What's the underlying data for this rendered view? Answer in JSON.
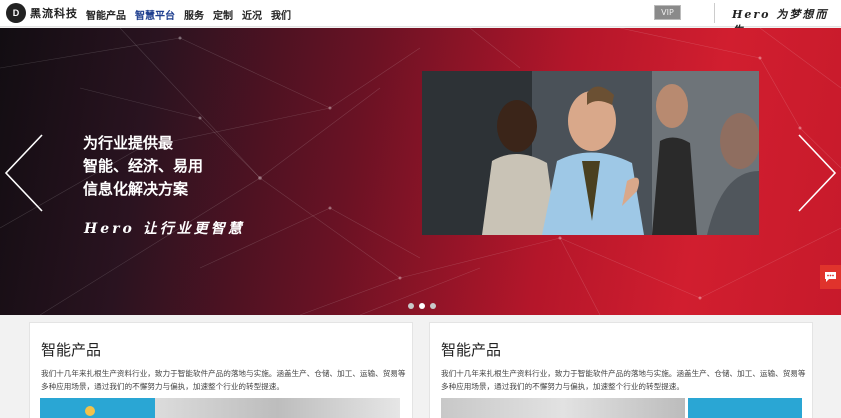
{
  "header": {
    "logo_mark": "D",
    "logo_text": "黑流科技",
    "nav": [
      "智能产品",
      "智慧平台",
      "服务",
      "定制",
      "近况",
      "我们"
    ],
    "active_index": 1,
    "vip_label": "VIP",
    "slogan": "Hero 为梦想而生"
  },
  "banner": {
    "headline": [
      "为行业提供最",
      "智能、经济、易用",
      "信息化解决方案"
    ],
    "slogan": "Hero 让行业更智慧",
    "slides": 3,
    "active_slide": 1
  },
  "cards": [
    {
      "title": "智能产品",
      "desc": "我们十几年来扎根生产资料行业，致力于智能软件产品的落地与实施。涵盖生产、仓储、加工、运输、贸易等多种应用场景，通过我们的不懈努力与偏执，加速整个行业的转型提速。"
    },
    {
      "title": "智能产品",
      "desc": "我们十几年来扎根生产资料行业，致力于智能软件产品的落地与实施。涵盖生产、仓储、加工、运输、贸易等多种应用场景，通过我们的不懈努力与偏执，加速整个行业的转型提速。"
    }
  ],
  "colors": {
    "accent": "#1f3f8f",
    "banner_red": "#d11e2f",
    "chat_red": "#e0332c",
    "thumb_blue": "#2aa6d4"
  },
  "icons": [
    "logo-mark",
    "chevron-left-icon",
    "chevron-right-icon",
    "chat-icon"
  ]
}
